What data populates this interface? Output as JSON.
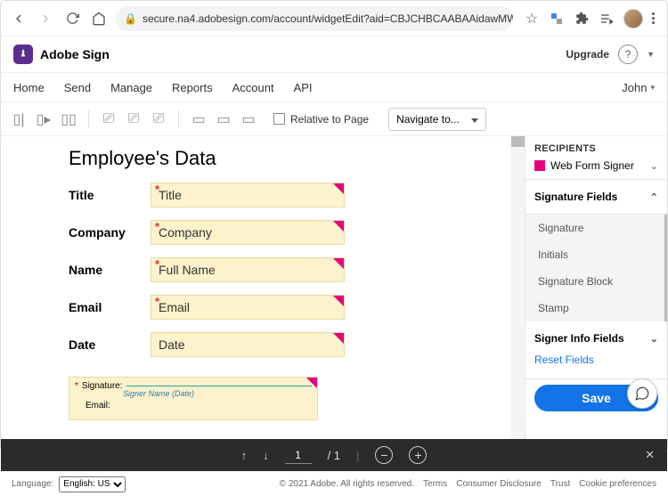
{
  "browser": {
    "url": "secure.na4.adobesign.com/account/widgetEdit?aid=CBJCHBCAABAAidawMWfFChqJ6GUkFpI5k1qY…"
  },
  "app": {
    "brand": "Adobe Sign",
    "upgrade": "Upgrade",
    "user": "John"
  },
  "nav": {
    "items": [
      "Home",
      "Send",
      "Manage",
      "Reports",
      "Account",
      "API"
    ]
  },
  "toolbar": {
    "relative_to_page": "Relative to Page",
    "navigate_to": "Navigate to..."
  },
  "document": {
    "title": "Employee's Data",
    "rows": [
      {
        "label": "Title",
        "value": "Title"
      },
      {
        "label": "Company",
        "value": "Company"
      },
      {
        "label": "Name",
        "value": "Full Name"
      },
      {
        "label": "Email",
        "value": "Email"
      },
      {
        "label": "Date",
        "value": "Date"
      }
    ],
    "sig_block": {
      "signature_label": "Signature:",
      "signer_placeholder": "Signer Name (Date)",
      "email_label": "Email:"
    }
  },
  "panel": {
    "recipients_head": "RECIPIENTS",
    "recipient": "Web Form Signer",
    "signature_fields": "Signature Fields",
    "fields": [
      "Signature",
      "Initials",
      "Signature Block",
      "Stamp"
    ],
    "signer_info": "Signer Info Fields",
    "reset": "Reset Fields",
    "save": "Save"
  },
  "pager": {
    "current": "1",
    "total": "/ 1"
  },
  "footer": {
    "language_label": "Language:",
    "language_value": "English: US",
    "copyright": "© 2021 Adobe. All rights reserved.",
    "links": [
      "Terms",
      "Consumer Disclosure",
      "Trust",
      "Cookie preferences"
    ]
  }
}
